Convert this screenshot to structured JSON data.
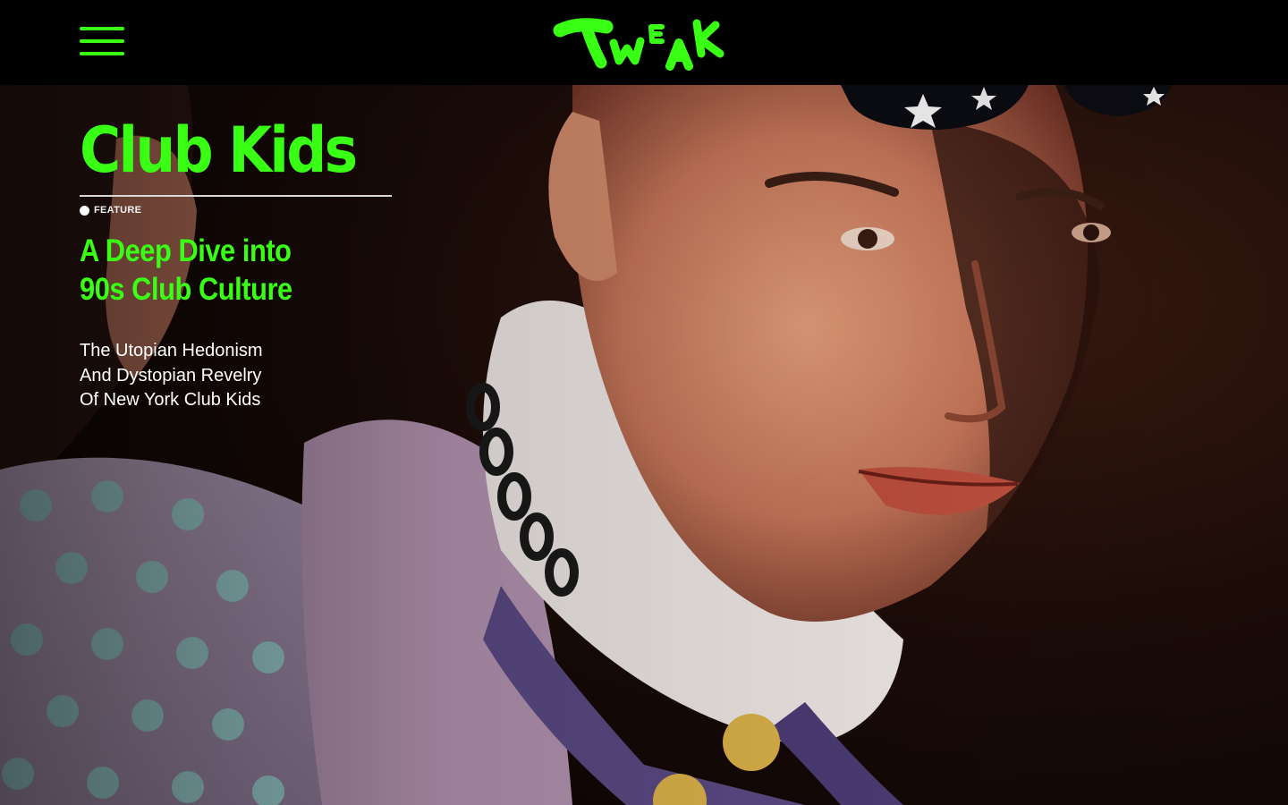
{
  "header": {
    "menu_icon": "hamburger-menu-icon",
    "logo_text": "TWEAK"
  },
  "hero": {
    "title": "Club Kids",
    "category": "FEATURE",
    "headline_lines": [
      "A Deep Dive into",
      "90s Club Culture"
    ],
    "dek_lines": [
      "The Utopian Hedonism",
      "And Dystopian Revelry",
      "Of New York Club Kids"
    ]
  },
  "colors": {
    "accent": "#39ff14",
    "bar": "#000000",
    "text": "#ffffff"
  }
}
